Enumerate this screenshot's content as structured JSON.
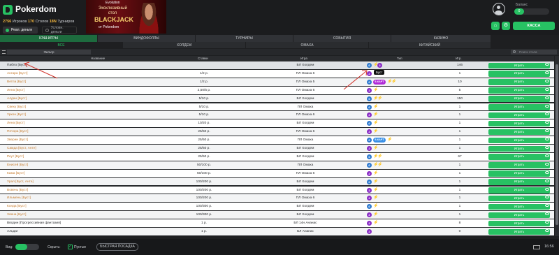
{
  "app": {
    "logo": "Pokerdom",
    "stats": {
      "players": "2756",
      "players_label": "Игроков",
      "tables": "170",
      "tables_label": "Столов",
      "tournaments": "18N",
      "tournaments_label": "Турниров"
    },
    "mode_real": "Реал. деньги",
    "mode_conditional": "Условн. деньги",
    "balance_label": "Баланс",
    "balance_value": "0",
    "cashier": "КАССА",
    "clock": "16:56"
  },
  "banner": {
    "brand": "Evolution",
    "line1": "Эксклюзивный",
    "line2": "стол",
    "title": "BLACKJACK",
    "from": "от Pokerdom"
  },
  "tabs_main": [
    "КЭШ-ИГРЫ",
    "ВИНДОФОЛЛЫ",
    "ТУРНИРЫ",
    "СОБЫТИЯ",
    "КАЗИНО"
  ],
  "tabs_sub": [
    "ВСЕ",
    "ХОЛДЕМ",
    "ОМАХА",
    "КИТАЙСКИЙ"
  ],
  "filter_label": "Фильтр",
  "search_placeholder": "Поиск стола",
  "columns": {
    "name": "Название",
    "stakes": "Ставки",
    "game": "Игра",
    "type": "Тип",
    "players": "Игр."
  },
  "tooltip": "Буст",
  "rows": [
    {
      "name": "Пабло [Буст]",
      "stakes": "",
      "game": "БЛ Холдем",
      "types": [
        "blue",
        "bolt-b",
        "purple"
      ],
      "players": "146",
      "play": "Играть"
    },
    {
      "name": "Ангара [Буст]",
      "stakes": "1/2 р.",
      "game": "ПЛ Омаха 6",
      "types": [
        "purple",
        "bolt"
      ],
      "players": "1",
      "play": "Играть"
    },
    {
      "name": "Ветла [Буст]",
      "stakes": "1/2 р.",
      "game": "ПЛ Омаха 5",
      "types": [
        "blue",
        "kart-purple",
        "bolt",
        "bolt"
      ],
      "players": "10",
      "play": "Играть"
    },
    {
      "name": "Лена [Буст]",
      "stakes": "2,50/5 р.",
      "game": "ПЛ Омаха 6",
      "types": [
        "purple",
        "bolt"
      ],
      "players": "5",
      "play": "Играть"
    },
    {
      "name": "Алдан [Буст]",
      "stakes": "5/10 р.",
      "game": "БЛ Холдем",
      "types": [
        "blue",
        "bolt",
        "bolt"
      ],
      "players": "150",
      "play": "Играть"
    },
    {
      "name": "Свеху [Буст]",
      "stakes": "5/10 р.",
      "game": "ПЛ Омаха",
      "types": [
        "blue",
        "bolt"
      ],
      "players": "1",
      "play": "Играть"
    },
    {
      "name": "Уркон [Буст]",
      "stakes": "5/10 р.",
      "game": "ПЛ Омаха 6",
      "types": [
        "purple",
        "bolt"
      ],
      "players": "1",
      "play": "Играть"
    },
    {
      "name": "Лена [Буст]",
      "stakes": "10/20 р.",
      "game": "БЛ Холдем",
      "types": [
        "blue",
        "bolt"
      ],
      "players": "1",
      "play": "Играть"
    },
    {
      "name": "Печора [Буст]",
      "stakes": "25/50 р.",
      "game": "ПЛ Омаха 6",
      "types": [
        "purple",
        "bolt"
      ],
      "players": "1",
      "play": "Играть"
    },
    {
      "name": "Зверин [Буст]",
      "stakes": "25/50 р.",
      "game": "ПЛ Омаха",
      "types": [
        "blue",
        "kart-blue",
        "bolt"
      ],
      "players": "1",
      "play": "Играть"
    },
    {
      "name": "Самда [Буст, Анте]",
      "stakes": "25/50 р.",
      "game": "БЛ Холдем",
      "types": [
        "purple",
        "bolt"
      ],
      "players": "1",
      "play": "Играть"
    },
    {
      "name": "Реут [Буст]",
      "stakes": "25/50 р.",
      "game": "БЛ Холдем",
      "types": [
        "blue",
        "bolt",
        "bolt"
      ],
      "players": "67",
      "play": "Играть"
    },
    {
      "name": "Енисей [Буст]",
      "stakes": "50/100 р.",
      "game": "ПЛ Омаха",
      "types": [
        "blue",
        "bolt",
        "bolt"
      ],
      "players": "1",
      "play": "Играть"
    },
    {
      "name": "Кама [Буст]",
      "stakes": "50/100 р.",
      "game": "ПЛ Омаха 6",
      "types": [
        "purple",
        "bolt"
      ],
      "players": "1",
      "play": "Играть"
    },
    {
      "name": "Урал [Буст, Анте]",
      "stakes": "100/200 р.",
      "game": "БЛ Холдем",
      "types": [
        "blue",
        "bolt"
      ],
      "players": "1",
      "play": "Играть"
    },
    {
      "name": "Вовень [Буст]",
      "stakes": "100/200 р.",
      "game": "БЛ Холдем",
      "types": [
        "purple",
        "bolt"
      ],
      "players": "1",
      "play": "Играть"
    },
    {
      "name": "Ильмень [Буст]",
      "stakes": "100/200 р.",
      "game": "ПЛ Омаха 6",
      "types": [
        "purple",
        "bolt"
      ],
      "players": "1",
      "play": "Играть"
    },
    {
      "name": "Конда [Буст]",
      "stakes": "100/300 р.",
      "game": "БЛ Холдем",
      "types": [
        "blue",
        "bolt"
      ],
      "players": "1",
      "play": "Играть"
    },
    {
      "name": "Хвача [Буст]",
      "stakes": "100/300 р.",
      "game": "БЛ Холдем",
      "types": [
        "purple",
        "bolt"
      ],
      "players": "1",
      "play": "Играть"
    },
    {
      "name": "Вводин [Прогрессивная фантазия]",
      "stakes": "1 р.",
      "game": "БЛ 14н Ананас",
      "types": [
        "purple",
        "bolt-p"
      ],
      "players": "8",
      "play": "Играть"
    },
    {
      "name": "Альдаг",
      "stakes": "1 р.",
      "game": "БЛ Ананас",
      "types": [
        "purple"
      ],
      "players": "0",
      "play": "Играть"
    }
  ],
  "footer": {
    "view_label": "Вид:",
    "hide_label": "Скрыть:",
    "empty_label": "Пустые",
    "quick_seat": "БЫСТРАЯ ПОСАДКА"
  },
  "colors": {
    "accent": "#27c163",
    "name_orange": "#c77c2e",
    "badge_blue": "#2f7bd1",
    "badge_purple": "#8a2cc7"
  }
}
